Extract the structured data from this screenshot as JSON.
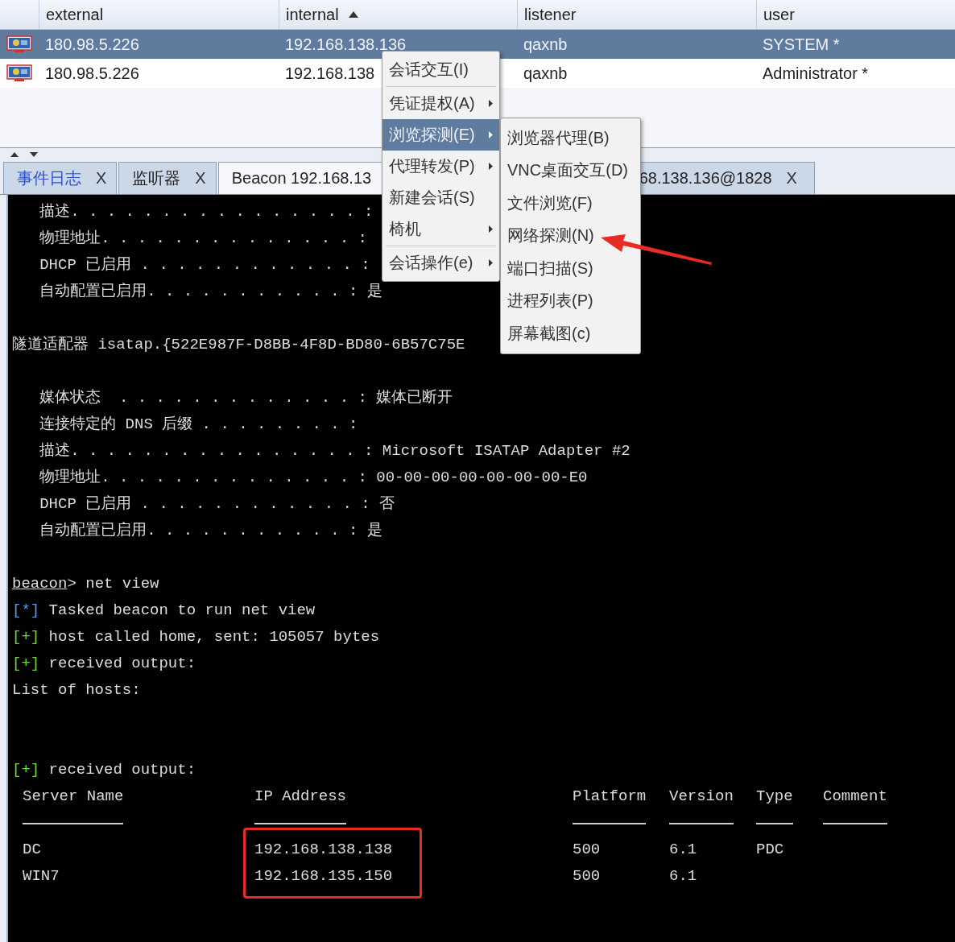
{
  "sessions": {
    "columns": [
      {
        "label": "external",
        "sorted": false
      },
      {
        "label": "internal",
        "sorted": true
      },
      {
        "label": "listener",
        "sorted": false
      },
      {
        "label": "user",
        "sorted": false
      }
    ],
    "rows": [
      {
        "cells": [
          "180.98.5.226",
          "192.168.138.136",
          "qaxnb",
          "SYSTEM *"
        ],
        "selected": true
      },
      {
        "cells": [
          "180.98.5.226",
          "192.168.138",
          "qaxnb",
          "Administrator *"
        ],
        "selected": false
      }
    ]
  },
  "tabs": [
    {
      "label": "事件日志",
      "close": "X",
      "selected": false,
      "highlighted": true
    },
    {
      "label": "监听器",
      "close": "X",
      "selected": false,
      "highlighted": false
    },
    {
      "label": "Beacon 192.168.13",
      "selected": true,
      "highlighted": false
    },
    {
      "label": "68.138.136@1828",
      "close": "X",
      "selected": false,
      "highlighted": false
    }
  ],
  "console": {
    "lines": [
      {
        "kind": "text",
        "text": "   描述. . . . . . . . . . . . . . . . :"
      },
      {
        "kind": "text",
        "text": "   物理地址. . . . . . . . . . . . . . :"
      },
      {
        "kind": "text",
        "text": "   DHCP 已启用 . . . . . . . . . . . . :"
      },
      {
        "kind": "text",
        "text": "   自动配置已启用. . . . . . . . . . . : 是"
      },
      {
        "kind": "blank"
      },
      {
        "kind": "text",
        "text": "隧道适配器 isatap.{522E987F-D8BB-4F8D-BD80-6B57C75E"
      },
      {
        "kind": "blank"
      },
      {
        "kind": "text",
        "text": "   媒体状态  . . . . . . . . . . . . . : 媒体已断开"
      },
      {
        "kind": "text",
        "text": "   连接特定的 DNS 后缀 . . . . . . . . :"
      },
      {
        "kind": "text",
        "text": "   描述. . . . . . . . . . . . . . . . : Microsoft ISATAP Adapter #2"
      },
      {
        "kind": "text",
        "text": "   物理地址. . . . . . . . . . . . . . : 00-00-00-00-00-00-00-E0"
      },
      {
        "kind": "text",
        "text": "   DHCP 已启用 . . . . . . . . . . . . : 否"
      },
      {
        "kind": "text",
        "text": "   自动配置已启用. . . . . . . . . . . : 是"
      },
      {
        "kind": "blank"
      },
      {
        "kind": "prompt",
        "prompt": "beacon",
        "text": "> net view"
      },
      {
        "kind": "status",
        "marker": "[*]",
        "color": "#5a9be0",
        "text": " Tasked beacon to run net view"
      },
      {
        "kind": "status",
        "marker": "[+]",
        "color": "#6fd63a",
        "text": " host called home, sent: 105057 bytes"
      },
      {
        "kind": "status",
        "marker": "[+]",
        "color": "#6fd63a",
        "text": " received output:"
      },
      {
        "kind": "text",
        "text": "List of hosts:"
      },
      {
        "kind": "blank"
      },
      {
        "kind": "blank"
      },
      {
        "kind": "status",
        "marker": "[+]",
        "color": "#6fd63a",
        "text": " received output:"
      },
      {
        "kind": "table",
        "columns": [
          "Server Name",
          "IP Address",
          "Platform",
          "Version",
          "Type",
          "Comment"
        ],
        "rows": [
          [
            "DC",
            "192.168.138.138",
            "500",
            "6.1",
            "PDC"
          ],
          [
            "WIN7",
            "192.168.135.150",
            "500",
            "6.1"
          ]
        ]
      }
    ]
  },
  "context_menu": {
    "items": [
      {
        "kind": "item",
        "label": "会话交互(I)",
        "submenu": false,
        "selected": false
      },
      {
        "kind": "separator"
      },
      {
        "kind": "item",
        "label": "凭证提权(A)",
        "submenu": true,
        "selected": false
      },
      {
        "kind": "item",
        "label": "浏览探测(E)",
        "submenu": true,
        "selected": true
      },
      {
        "kind": "item",
        "label": "代理转发(P)",
        "submenu": true,
        "selected": false
      },
      {
        "kind": "item",
        "label": "新建会话(S)",
        "submenu": false,
        "selected": false
      },
      {
        "kind": "item",
        "label": "椅机",
        "submenu": true,
        "selected": false
      },
      {
        "kind": "separator"
      },
      {
        "kind": "item",
        "label": "会话操作(e)",
        "submenu": true,
        "selected": false
      }
    ]
  },
  "submenu": {
    "items": [
      {
        "label": "浏览器代理(B)",
        "selected": false
      },
      {
        "label": "VNC桌面交互(D)",
        "selected": false
      },
      {
        "label": "文件浏览(F)",
        "selected": false
      },
      {
        "label": "网络探测(N)",
        "selected": false
      },
      {
        "label": "端口扫描(S)",
        "selected": false
      },
      {
        "label": "进程列表(P)",
        "selected": false
      },
      {
        "label": "屏幕截图(c)",
        "selected": false
      }
    ]
  }
}
